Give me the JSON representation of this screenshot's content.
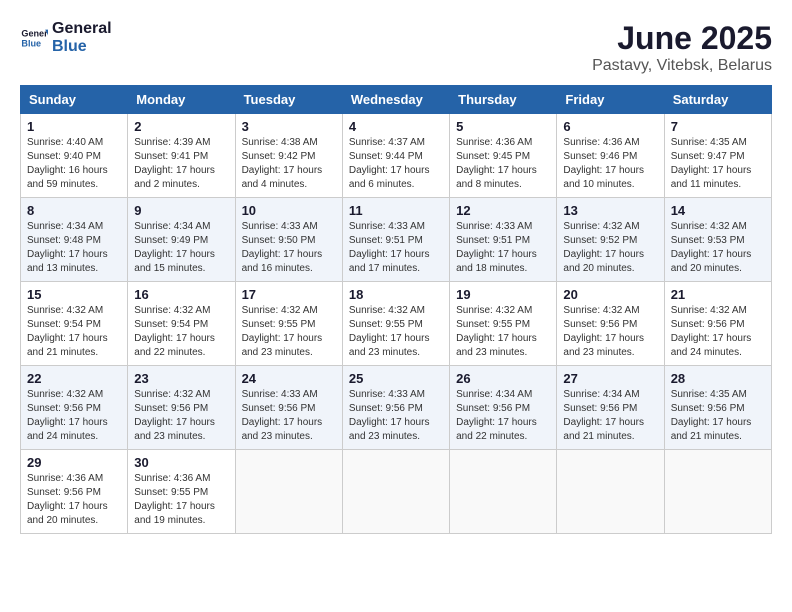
{
  "header": {
    "logo_general": "General",
    "logo_blue": "Blue",
    "title": "June 2025",
    "subtitle": "Pastavy, Vitebsk, Belarus"
  },
  "days_of_week": [
    "Sunday",
    "Monday",
    "Tuesday",
    "Wednesday",
    "Thursday",
    "Friday",
    "Saturday"
  ],
  "weeks": [
    [
      {
        "day": "1",
        "sunrise": "Sunrise: 4:40 AM",
        "sunset": "Sunset: 9:40 PM",
        "daylight": "Daylight: 16 hours and 59 minutes."
      },
      {
        "day": "2",
        "sunrise": "Sunrise: 4:39 AM",
        "sunset": "Sunset: 9:41 PM",
        "daylight": "Daylight: 17 hours and 2 minutes."
      },
      {
        "day": "3",
        "sunrise": "Sunrise: 4:38 AM",
        "sunset": "Sunset: 9:42 PM",
        "daylight": "Daylight: 17 hours and 4 minutes."
      },
      {
        "day": "4",
        "sunrise": "Sunrise: 4:37 AM",
        "sunset": "Sunset: 9:44 PM",
        "daylight": "Daylight: 17 hours and 6 minutes."
      },
      {
        "day": "5",
        "sunrise": "Sunrise: 4:36 AM",
        "sunset": "Sunset: 9:45 PM",
        "daylight": "Daylight: 17 hours and 8 minutes."
      },
      {
        "day": "6",
        "sunrise": "Sunrise: 4:36 AM",
        "sunset": "Sunset: 9:46 PM",
        "daylight": "Daylight: 17 hours and 10 minutes."
      },
      {
        "day": "7",
        "sunrise": "Sunrise: 4:35 AM",
        "sunset": "Sunset: 9:47 PM",
        "daylight": "Daylight: 17 hours and 11 minutes."
      }
    ],
    [
      {
        "day": "8",
        "sunrise": "Sunrise: 4:34 AM",
        "sunset": "Sunset: 9:48 PM",
        "daylight": "Daylight: 17 hours and 13 minutes."
      },
      {
        "day": "9",
        "sunrise": "Sunrise: 4:34 AM",
        "sunset": "Sunset: 9:49 PM",
        "daylight": "Daylight: 17 hours and 15 minutes."
      },
      {
        "day": "10",
        "sunrise": "Sunrise: 4:33 AM",
        "sunset": "Sunset: 9:50 PM",
        "daylight": "Daylight: 17 hours and 16 minutes."
      },
      {
        "day": "11",
        "sunrise": "Sunrise: 4:33 AM",
        "sunset": "Sunset: 9:51 PM",
        "daylight": "Daylight: 17 hours and 17 minutes."
      },
      {
        "day": "12",
        "sunrise": "Sunrise: 4:33 AM",
        "sunset": "Sunset: 9:51 PM",
        "daylight": "Daylight: 17 hours and 18 minutes."
      },
      {
        "day": "13",
        "sunrise": "Sunrise: 4:32 AM",
        "sunset": "Sunset: 9:52 PM",
        "daylight": "Daylight: 17 hours and 20 minutes."
      },
      {
        "day": "14",
        "sunrise": "Sunrise: 4:32 AM",
        "sunset": "Sunset: 9:53 PM",
        "daylight": "Daylight: 17 hours and 20 minutes."
      }
    ],
    [
      {
        "day": "15",
        "sunrise": "Sunrise: 4:32 AM",
        "sunset": "Sunset: 9:54 PM",
        "daylight": "Daylight: 17 hours and 21 minutes."
      },
      {
        "day": "16",
        "sunrise": "Sunrise: 4:32 AM",
        "sunset": "Sunset: 9:54 PM",
        "daylight": "Daylight: 17 hours and 22 minutes."
      },
      {
        "day": "17",
        "sunrise": "Sunrise: 4:32 AM",
        "sunset": "Sunset: 9:55 PM",
        "daylight": "Daylight: 17 hours and 23 minutes."
      },
      {
        "day": "18",
        "sunrise": "Sunrise: 4:32 AM",
        "sunset": "Sunset: 9:55 PM",
        "daylight": "Daylight: 17 hours and 23 minutes."
      },
      {
        "day": "19",
        "sunrise": "Sunrise: 4:32 AM",
        "sunset": "Sunset: 9:55 PM",
        "daylight": "Daylight: 17 hours and 23 minutes."
      },
      {
        "day": "20",
        "sunrise": "Sunrise: 4:32 AM",
        "sunset": "Sunset: 9:56 PM",
        "daylight": "Daylight: 17 hours and 23 minutes."
      },
      {
        "day": "21",
        "sunrise": "Sunrise: 4:32 AM",
        "sunset": "Sunset: 9:56 PM",
        "daylight": "Daylight: 17 hours and 24 minutes."
      }
    ],
    [
      {
        "day": "22",
        "sunrise": "Sunrise: 4:32 AM",
        "sunset": "Sunset: 9:56 PM",
        "daylight": "Daylight: 17 hours and 24 minutes."
      },
      {
        "day": "23",
        "sunrise": "Sunrise: 4:32 AM",
        "sunset": "Sunset: 9:56 PM",
        "daylight": "Daylight: 17 hours and 23 minutes."
      },
      {
        "day": "24",
        "sunrise": "Sunrise: 4:33 AM",
        "sunset": "Sunset: 9:56 PM",
        "daylight": "Daylight: 17 hours and 23 minutes."
      },
      {
        "day": "25",
        "sunrise": "Sunrise: 4:33 AM",
        "sunset": "Sunset: 9:56 PM",
        "daylight": "Daylight: 17 hours and 23 minutes."
      },
      {
        "day": "26",
        "sunrise": "Sunrise: 4:34 AM",
        "sunset": "Sunset: 9:56 PM",
        "daylight": "Daylight: 17 hours and 22 minutes."
      },
      {
        "day": "27",
        "sunrise": "Sunrise: 4:34 AM",
        "sunset": "Sunset: 9:56 PM",
        "daylight": "Daylight: 17 hours and 21 minutes."
      },
      {
        "day": "28",
        "sunrise": "Sunrise: 4:35 AM",
        "sunset": "Sunset: 9:56 PM",
        "daylight": "Daylight: 17 hours and 21 minutes."
      }
    ],
    [
      {
        "day": "29",
        "sunrise": "Sunrise: 4:36 AM",
        "sunset": "Sunset: 9:56 PM",
        "daylight": "Daylight: 17 hours and 20 minutes."
      },
      {
        "day": "30",
        "sunrise": "Sunrise: 4:36 AM",
        "sunset": "Sunset: 9:55 PM",
        "daylight": "Daylight: 17 hours and 19 minutes."
      },
      null,
      null,
      null,
      null,
      null
    ]
  ]
}
